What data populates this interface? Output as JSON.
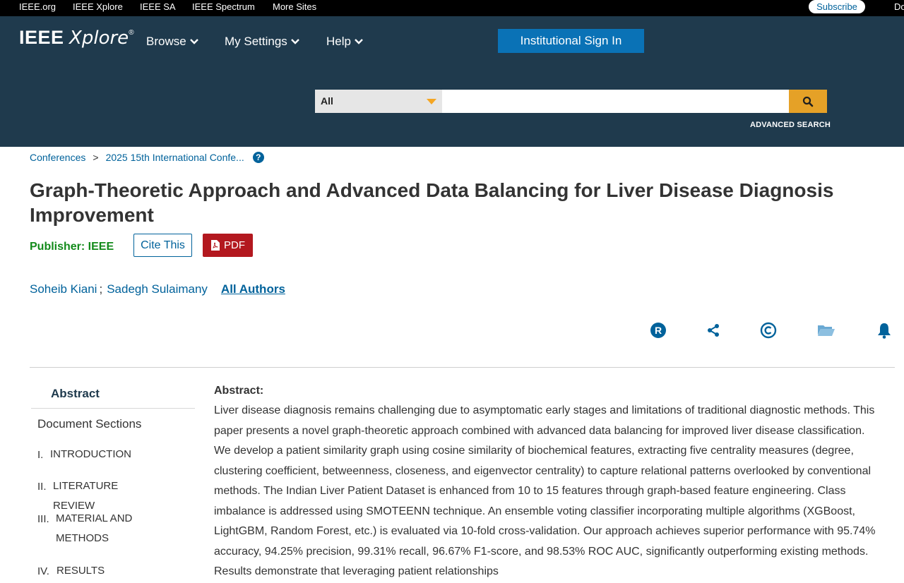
{
  "topbar": {
    "links": [
      "IEEE.org",
      "IEEE Xplore",
      "IEEE SA",
      "IEEE Spectrum",
      "More Sites"
    ],
    "subscribe": "Subscribe",
    "cut_text": "Do"
  },
  "header": {
    "logo_ieee": "IEEE",
    "logo_xplore": "Xplore",
    "logo_reg": "®",
    "nav": [
      "Browse",
      "My Settings",
      "Help"
    ],
    "signin": "Institutional Sign In",
    "search_scope": "All",
    "search_placeholder": "",
    "advanced_search": "ADVANCED SEARCH"
  },
  "breadcrumb": {
    "items": [
      "Conferences",
      "2025 15th International Confe..."
    ],
    "separator": ">",
    "help": "?"
  },
  "paper": {
    "title": "Graph-Theoretic Approach and Advanced Data Balancing for Liver Disease Diagnosis Improvement",
    "publisher": "Publisher: IEEE",
    "cite": "Cite This",
    "pdf": "PDF",
    "authors": [
      "Soheib Kiani",
      "Sadegh Sulaimany"
    ],
    "author_sep": ";",
    "all_authors": "All Authors"
  },
  "tools": [
    "rights-icon",
    "share-icon",
    "copyright-icon",
    "folder-icon",
    "alert-bell-icon"
  ],
  "sidebar": {
    "abstract": "Abstract",
    "document_sections": "Document Sections",
    "sections": [
      {
        "num": "I.",
        "label": "INTRODUCTION"
      },
      {
        "num": "II.",
        "label": "LITERATURE REVIEW"
      },
      {
        "num": "III.",
        "label": "MATERIAL AND METHODS"
      },
      {
        "num": "IV.",
        "label": "RESULTS"
      }
    ]
  },
  "abstract": {
    "heading": "Abstract:",
    "text": "Liver disease diagnosis remains challenging due to asymptomatic early stages and limitations of traditional diagnostic methods. This paper presents a novel graph-theoretic approach combined with advanced data balancing for improved liver disease classification. We develop a patient similarity graph using cosine similarity of biochemical features, extracting five centrality measures (degree, clustering coefficient, betweenness, closeness, and eigenvector centrality) to capture relational patterns overlooked by conventional methods. The Indian Liver Patient Dataset is enhanced from 10 to 15 features through graph-based feature engineering. Class imbalance is addressed using SMOTEENN technique. An ensemble voting classifier incorporating multiple algorithms (XGBoost, LightGBM, Random Forest, etc.) is evaluated via 10-fold cross-validation. Our approach achieves superior performance with 95.74% accuracy, 94.25% precision, 99.31% recall, 96.67% F1-score, and 98.53% ROC AUC, significantly outperforming existing methods. Results demonstrate that leveraging patient relationships"
  },
  "colors": {
    "header_bg": "#1f3a4d",
    "link": "#00629b",
    "publisher_green": "#128a1a",
    "pdf_red": "#b3181f",
    "search_btn": "#e5a127",
    "signin_bg": "#0a72b6"
  }
}
